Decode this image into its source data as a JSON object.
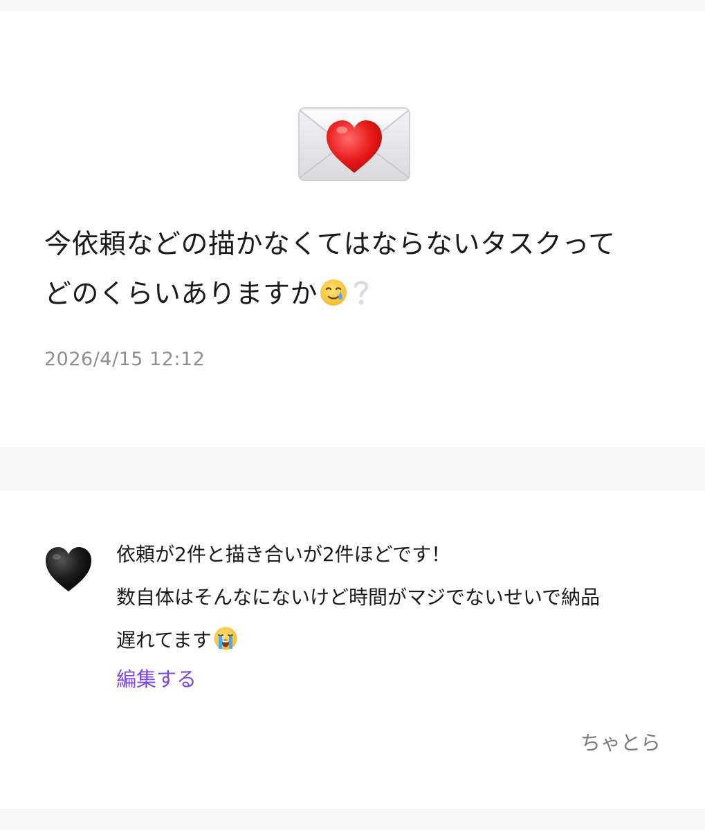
{
  "question": {
    "icon": "love-letter-envelope-icon",
    "text_line1": "今依頼などの描かなくてはならないタスクって",
    "text_line2": "どのくらいありますか",
    "trailing_emoji": [
      "smiling-face-with-tear-icon",
      "white-question-mark-icon"
    ],
    "timestamp": "2026/4/15 12:12"
  },
  "answer": {
    "avatar_icon": "black-heart-icon",
    "lines": [
      "依頼が2件と描き合いが2件ほどです！",
      "数自体はそんなにないけど時間がマジでないせいで納品",
      "遅れてます"
    ],
    "trailing_emoji": "loudly-crying-face-icon",
    "edit_label": "編集する",
    "author": "ちゃとら"
  },
  "colors": {
    "background_gap": "#f7f7f7",
    "card": "#ffffff",
    "text": "#1a1a1a",
    "timestamp": "#8e8e8e",
    "link": "#7b45e8",
    "author": "#7a7a7a"
  }
}
